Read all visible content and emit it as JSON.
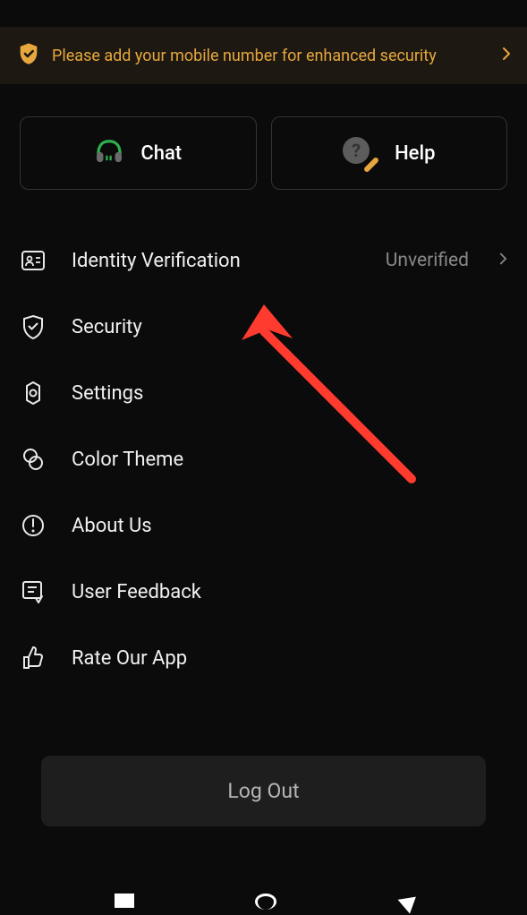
{
  "banner": {
    "message": "Please add your mobile number for enhanced security"
  },
  "actions": {
    "chat": {
      "label": "Chat"
    },
    "help": {
      "label": "Help"
    }
  },
  "menu": {
    "identity": {
      "label": "Identity Verification",
      "status": "Unverified"
    },
    "security": {
      "label": "Security"
    },
    "settings": {
      "label": "Settings"
    },
    "theme": {
      "label": "Color Theme"
    },
    "about": {
      "label": "About Us"
    },
    "feedback": {
      "label": "User Feedback"
    },
    "rate": {
      "label": "Rate Our App"
    }
  },
  "logout": {
    "label": "Log Out"
  },
  "colors": {
    "accent": "#e6a73e",
    "arrow": "#ff3b2f"
  }
}
